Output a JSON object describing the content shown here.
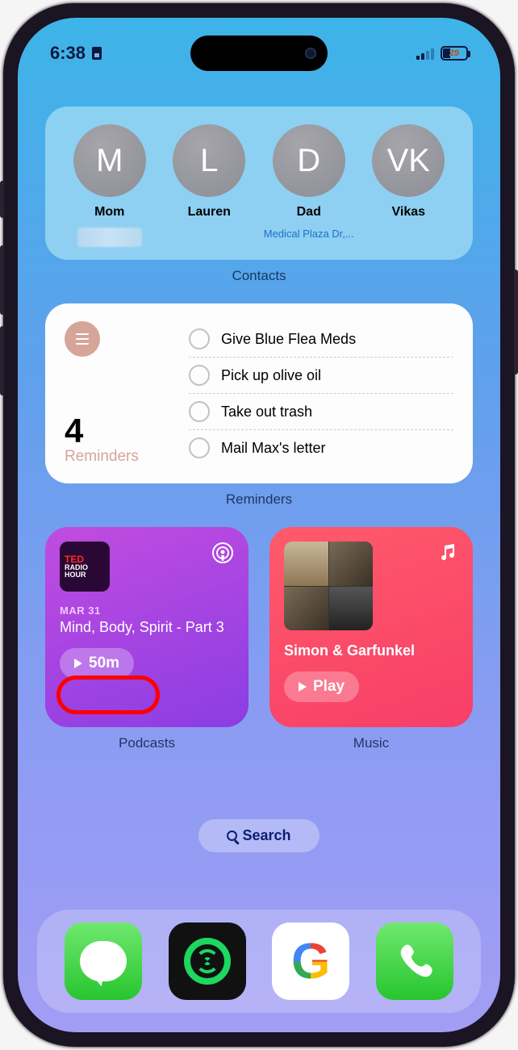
{
  "status": {
    "time": "6:38",
    "battery_pct": "29"
  },
  "contacts": {
    "label": "Contacts",
    "items": [
      {
        "initial": "M",
        "name": "Mom",
        "sub": ""
      },
      {
        "initial": "L",
        "name": "Lauren",
        "sub": ""
      },
      {
        "initial": "D",
        "name": "Dad",
        "sub": "Medical Plaza Dr,..."
      },
      {
        "initial": "VK",
        "name": "Vikas",
        "sub": ""
      }
    ]
  },
  "reminders": {
    "label": "Reminders",
    "count": "4",
    "title": "Reminders",
    "items": [
      "Give Blue Flea Meds",
      "Pick up olive oil",
      "Take out trash",
      "Mail Max's letter"
    ]
  },
  "podcasts": {
    "label": "Podcasts",
    "art_line1": "TED",
    "art_line2": "RADIO",
    "art_line3": "HOUR",
    "date": "MAR 31",
    "title": "Mind, Body, Spirit - Part 3",
    "pill": "50m"
  },
  "music": {
    "label": "Music",
    "title": "Simon & Garfunkel",
    "pill": "Play"
  },
  "search": {
    "label": "Search"
  }
}
